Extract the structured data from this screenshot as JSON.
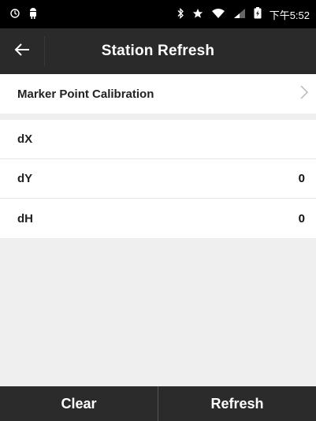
{
  "status_bar": {
    "left_icons": [
      "sync-icon",
      "android-icon"
    ],
    "right_icons": [
      "bluetooth-icon",
      "star-icon",
      "wifi-icon",
      "signal-icon",
      "battery-icon"
    ],
    "time": "下午5:52"
  },
  "header": {
    "title": "Station Refresh"
  },
  "calibration": {
    "label": "Marker Point Calibration"
  },
  "fields": [
    {
      "label": "dX",
      "value": ""
    },
    {
      "label": "dY",
      "value": "0"
    },
    {
      "label": "dH",
      "value": "0"
    }
  ],
  "actions": {
    "clear_label": "Clear",
    "refresh_label": "Refresh"
  },
  "colors": {
    "status_bar": "#000000",
    "app_bar": "#2a2a2a",
    "background": "#efefef",
    "bottom_bar": "#2b2b2b"
  }
}
